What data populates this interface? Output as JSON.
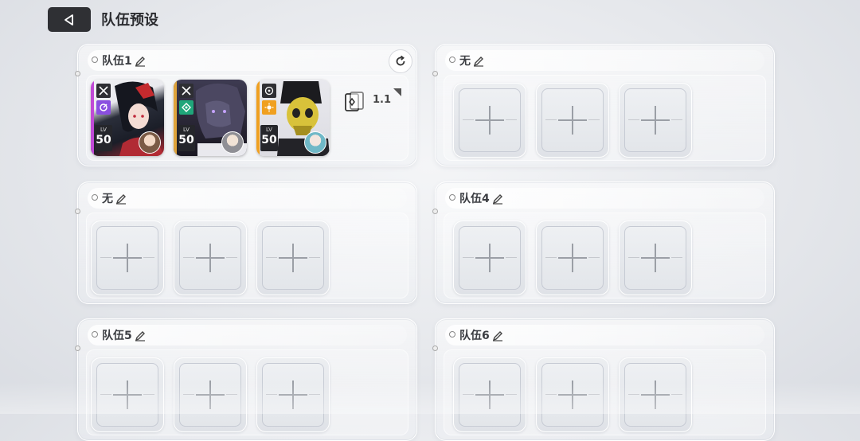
{
  "header": {
    "title": "队伍预设",
    "back_icon": "back-triangle-icon"
  },
  "teams": [
    {
      "name": "队伍1",
      "members": [
        {
          "level_label": "LV",
          "level": "50",
          "class_icon": "crossed-swords-icon",
          "element_icon": "spiral-icon",
          "element_color": "#8a4fe0",
          "accent": "#c14ad6"
        },
        {
          "level_label": "LV",
          "level": "50",
          "class_icon": "crossed-swords-icon",
          "element_icon": "diamond-icon",
          "element_color": "#1fa67a",
          "accent": "#e0a43b"
        },
        {
          "level_label": "LV",
          "level": "50",
          "class_icon": "target-icon",
          "element_icon": "sun-icon",
          "element_color": "#f0a020",
          "accent": "#f0a020"
        }
      ],
      "deck_ratio": "1.1",
      "refresh_icon": "refresh-icon"
    },
    {
      "name": "无"
    },
    {
      "name": "无"
    },
    {
      "name": "队伍4"
    },
    {
      "name": "队伍5"
    },
    {
      "name": "队伍6"
    }
  ]
}
